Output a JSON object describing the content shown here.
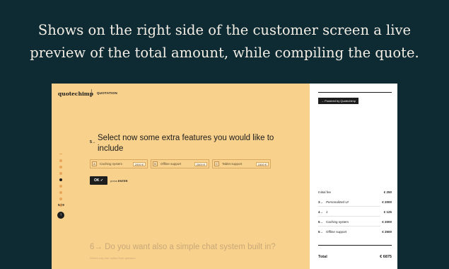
{
  "headline": {
    "line1": "Shows on the right side of the customer screen a live",
    "line2": "preview of the total amount, while compiling the quote."
  },
  "app": {
    "brand": "quotechimp",
    "section": "QUOTATION"
  },
  "question": {
    "number": "5→",
    "title": "Select now some extra features you would like to include",
    "options": [
      {
        "key": "A",
        "label": "Caching system",
        "price": "2000 €"
      },
      {
        "key": "B",
        "label": "Offline support",
        "price": "2500 €"
      },
      {
        "key": "C",
        "label": "Tablet support",
        "price": "1500 €"
      }
    ],
    "ok_label": "OK ✓",
    "press_prefix": "press",
    "press_key": "ENTER"
  },
  "next_question": {
    "title": "6→ Do you want also a simple chat system built in?",
    "subtitle": "Select only one option from question"
  },
  "progress": {
    "step_text": "5 / 9",
    "up_icon": "arrow-up-icon"
  },
  "summary": {
    "powered_label": "→ Powered by Quotechimp",
    "initial_fee_label": "Initial fee",
    "initial_fee_amount": "€ 250",
    "items": [
      {
        "step": "3→",
        "label": "Personalized UI",
        "amount": "€ 2000"
      },
      {
        "step": "4→",
        "label": "1",
        "amount": "€ 125"
      },
      {
        "step": "5→",
        "label": "Caching system",
        "amount": "€ 2000"
      },
      {
        "step": "5→",
        "label": "Offline support",
        "amount": "€ 2500"
      }
    ],
    "total_label": "Total",
    "total_amount": "€ 6875"
  },
  "colors": {
    "background": "#0e2a33",
    "form_bg": "#f8d18d",
    "accent_dark": "#1d1d1d",
    "progress_dot": "#e8a658"
  }
}
